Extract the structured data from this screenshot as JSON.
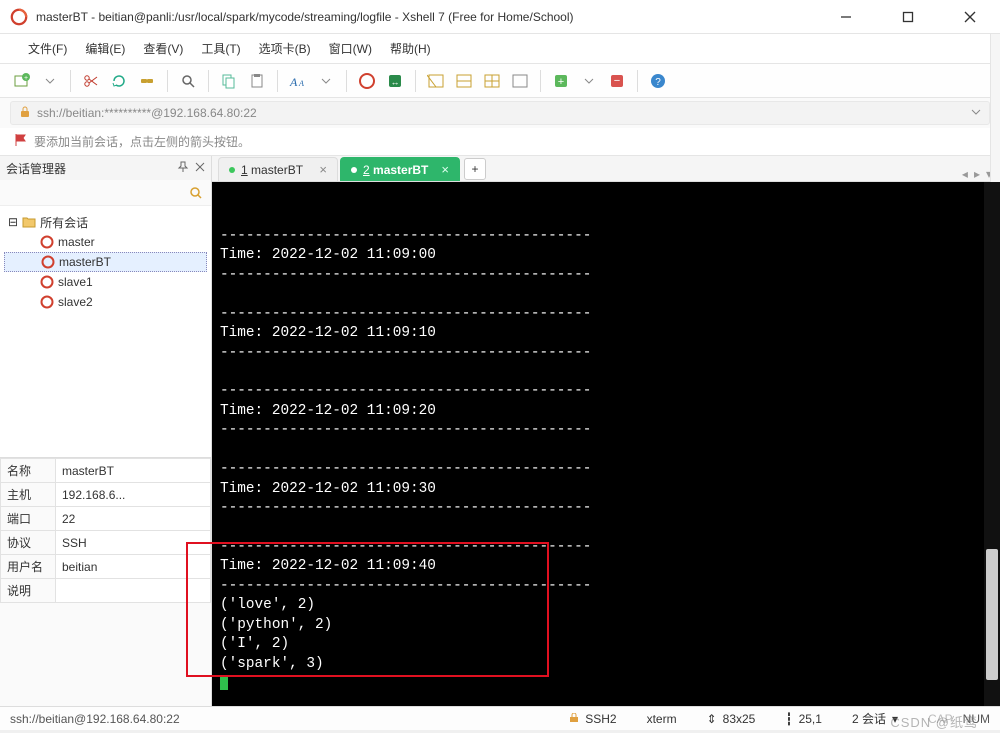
{
  "window": {
    "title": "masterBT - beitian@panli:/usr/local/spark/mycode/streaming/logfile - Xshell 7 (Free for Home/School)"
  },
  "menu": {
    "file": "文件(F)",
    "edit": "编辑(E)",
    "view": "查看(V)",
    "tools": "工具(T)",
    "tabs": "选项卡(B)",
    "window": "窗口(W)",
    "help": "帮助(H)"
  },
  "addressbar": {
    "text": "ssh://beitian:**********@192.168.64.80:22"
  },
  "notice": {
    "text": "要添加当前会话，点击左侧的箭头按钮。"
  },
  "sidebar": {
    "title": "会话管理器",
    "root": "所有会话",
    "sessions": [
      "master",
      "masterBT",
      "slave1",
      "slave2"
    ],
    "selected": "masterBT"
  },
  "props": {
    "rows": [
      [
        "名称",
        "masterBT"
      ],
      [
        "主机",
        "192.168.6..."
      ],
      [
        "端口",
        "22"
      ],
      [
        "协议",
        "SSH"
      ],
      [
        "用户名",
        "beitian"
      ],
      [
        "说明",
        ""
      ]
    ]
  },
  "tabs": {
    "items": [
      {
        "label": "1 masterBT",
        "underline": "1",
        "active": false
      },
      {
        "label": "2 masterBT",
        "underline": "2",
        "active": true
      }
    ]
  },
  "terminal": {
    "lines": [
      "-------------------------------------------",
      "Time: 2022-12-02 11:09:00",
      "-------------------------------------------",
      "",
      "-------------------------------------------",
      "Time: 2022-12-02 11:09:10",
      "-------------------------------------------",
      "",
      "-------------------------------------------",
      "Time: 2022-12-02 11:09:20",
      "-------------------------------------------",
      "",
      "-------------------------------------------",
      "Time: 2022-12-02 11:09:30",
      "-------------------------------------------",
      "",
      "-------------------------------------------",
      "Time: 2022-12-02 11:09:40",
      "-------------------------------------------",
      "('love', 2)",
      "('python', 2)",
      "('I', 2)",
      "('spark', 3)",
      ""
    ]
  },
  "statusbar": {
    "left": "ssh://beitian@192.168.64.80:22",
    "ssh": "SSH2",
    "term": "xterm",
    "size": "83x25",
    "pos": "25,1",
    "sessions": "2 会话",
    "cap": "CAP",
    "num": "NUM"
  },
  "watermark": "CSDN @纸鸾"
}
